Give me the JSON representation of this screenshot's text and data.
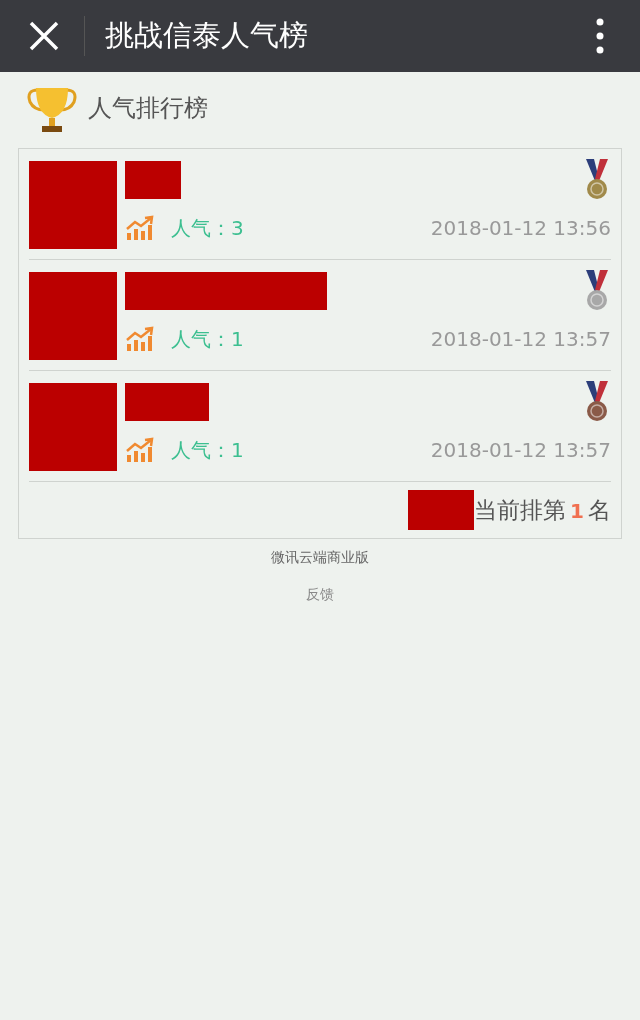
{
  "window": {
    "title": "挑战信泰人气榜"
  },
  "heading": "人气排行榜",
  "entries": [
    {
      "popularity_label": "人气：",
      "popularity": "3",
      "time": "2018-01-12 13:56",
      "color": "#a08a4a"
    },
    {
      "popularity_label": "人气：",
      "popularity": "1",
      "time": "2018-01-12 13:57",
      "color": "#a8a8a8"
    },
    {
      "popularity_label": "人气：",
      "popularity": "1",
      "time": "2018-01-12 13:57",
      "color": "#8a5a48"
    }
  ],
  "my_rank": {
    "prefix": "当前排第",
    "rank": "1",
    "suffix": "名"
  },
  "footer": {
    "brand": "微讯云端商业版",
    "feedback": "反馈"
  }
}
